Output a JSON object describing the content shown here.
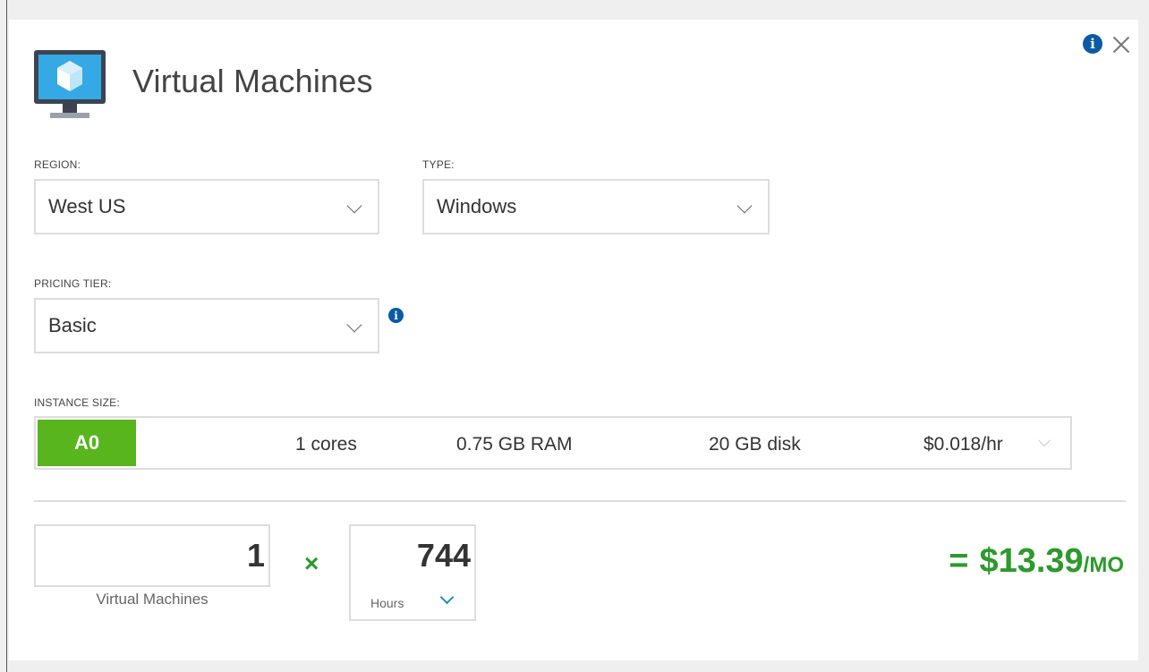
{
  "header": {
    "title": "Virtual Machines"
  },
  "region": {
    "label": "REGION:",
    "value": "West US"
  },
  "type": {
    "label": "TYPE:",
    "value": "Windows"
  },
  "pricing_tier": {
    "label": "PRICING TIER:",
    "value": "Basic"
  },
  "instance_size": {
    "label": "INSTANCE SIZE:",
    "name": "A0",
    "cores": "1 cores",
    "ram": "0.75 GB RAM",
    "disk": "20 GB disk",
    "price": "$0.018/hr"
  },
  "calc": {
    "vm_count": "1",
    "vm_label": "Virtual Machines",
    "times": "×",
    "hours": "744",
    "hours_unit": "Hours",
    "equals": "=",
    "total": "$13.39",
    "per": "/MO"
  },
  "colors": {
    "accent_green": "#58b51e",
    "total_green": "#2c9a2c",
    "info_blue": "#0a5aa8"
  }
}
